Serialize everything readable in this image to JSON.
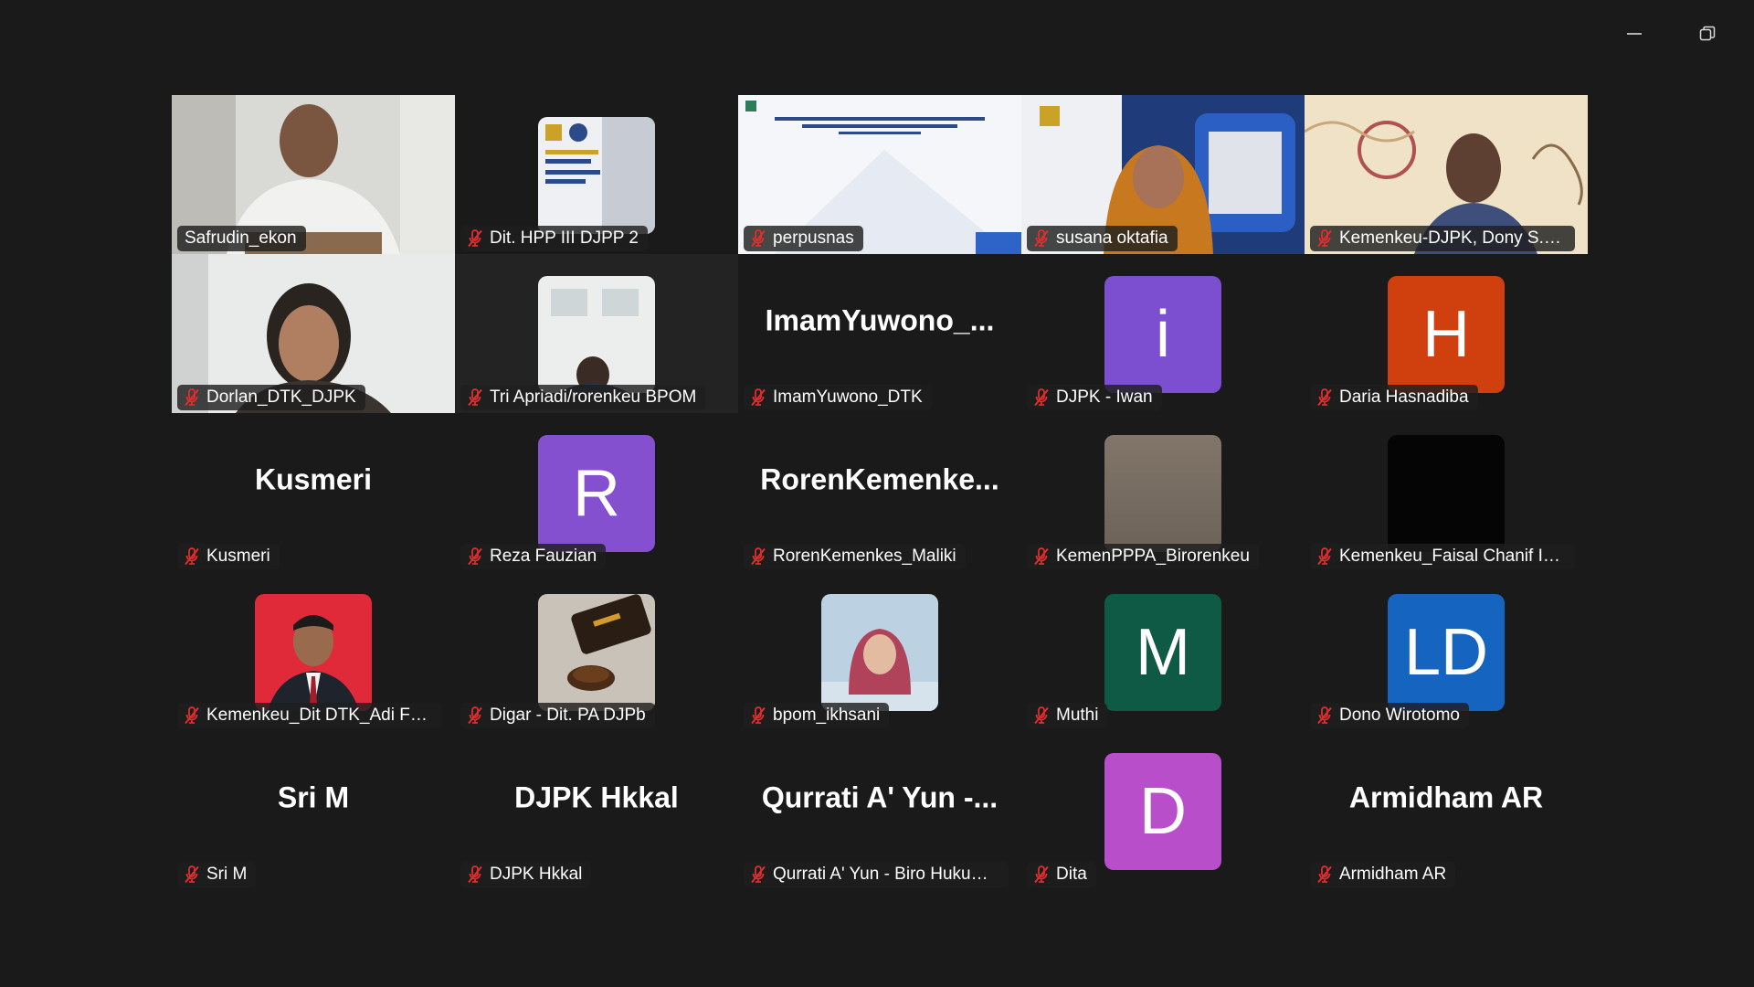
{
  "window": {
    "minimize_label": "–",
    "restore_label": "❐"
  },
  "colors": {
    "active_speaker_border": "#23d959",
    "muted_icon": "#e02d2d"
  },
  "participants": [
    {
      "name": "Safrudin_ekon",
      "type": "video-person",
      "active": true
    },
    {
      "name": "Dit. HPP III DJPP 2",
      "type": "thumb-banner"
    },
    {
      "name": "perpusnas",
      "type": "video-slide"
    },
    {
      "name": "susana oktafia",
      "type": "video-person-banner"
    },
    {
      "name": "Kemenkeu-DJPK, Dony S. Pri...",
      "type": "video-person-batik"
    },
    {
      "name": "Dorlan_DTK_DJPK",
      "type": "video-person-woman"
    },
    {
      "name": "Tri Apriadi/rorenkeu BPOM",
      "type": "thumb-office"
    },
    {
      "name": "ImamYuwono_DTK",
      "type": "text",
      "big_name": "ImamYuwono_..."
    },
    {
      "name": "DJPK - Iwan",
      "type": "avatar",
      "initial": "i",
      "color": "#7b4fcf"
    },
    {
      "name": "Daria Hasnadiba",
      "type": "avatar",
      "initial": "H",
      "color": "#d0400f"
    },
    {
      "name": "Kusmeri",
      "type": "text",
      "big_name": "Kusmeri"
    },
    {
      "name": "Reza Fauzian",
      "type": "avatar",
      "initial": "R",
      "color": "#8450d0"
    },
    {
      "name": "RorenKemenkes_Maliki",
      "type": "text",
      "big_name": "RorenKemenke..."
    },
    {
      "name": "KemenPPPA_Birorenkeu",
      "type": "thumb-blur"
    },
    {
      "name": "Kemenkeu_Faisal Chanif Izz...",
      "type": "thumb-black"
    },
    {
      "name": "Kemenkeu_Dit DTK_Adi Fahmi",
      "type": "thumb-portrait"
    },
    {
      "name": "Digar - Dit. PA DJPb",
      "type": "thumb-coffee"
    },
    {
      "name": "bpom_ikhsani",
      "type": "thumb-hijab"
    },
    {
      "name": "Muthi",
      "type": "avatar",
      "initial": "M",
      "color": "#0e5a45"
    },
    {
      "name": "Dono Wirotomo",
      "type": "avatar",
      "initial": "LD",
      "color": "#1565c0"
    },
    {
      "name": "Sri M",
      "type": "text",
      "big_name": "Sri M"
    },
    {
      "name": "DJPK Hkkal",
      "type": "text",
      "big_name": "DJPK Hkkal"
    },
    {
      "name": "Qurrati A' Yun - Biro Hukum...",
      "type": "text",
      "big_name": "Qurrati A' Yun -..."
    },
    {
      "name": "Dita",
      "type": "avatar",
      "initial": "D",
      "color": "#b84ec9"
    },
    {
      "name": "Armidham AR",
      "type": "text",
      "big_name": "Armidham AR"
    }
  ]
}
